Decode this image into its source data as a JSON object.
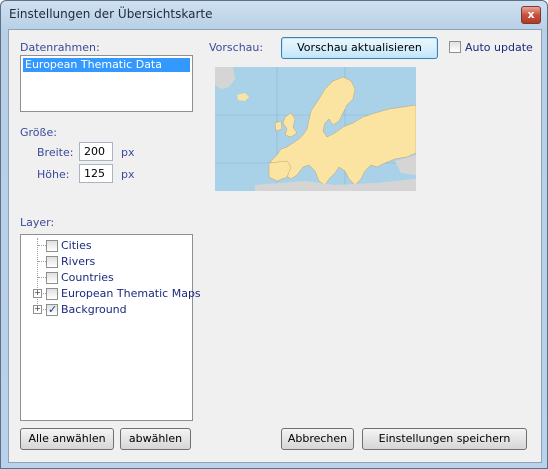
{
  "window": {
    "title": "Einstellungen der Übersichtskarte",
    "close_glyph": "x"
  },
  "datenrahmen": {
    "label": "Datenrahmen:",
    "items": [
      "European Thematic Data"
    ]
  },
  "groesse": {
    "label": "Größe:",
    "breite_label": "Breite:",
    "breite_value": "200",
    "hoehe_label": "Höhe:",
    "hoehe_value": "125",
    "unit": "px"
  },
  "layer": {
    "label": "Layer:",
    "items": [
      {
        "label": "Cities",
        "checked": false,
        "expandable": false
      },
      {
        "label": "Rivers",
        "checked": false,
        "expandable": false
      },
      {
        "label": "Countries",
        "checked": false,
        "expandable": false
      },
      {
        "label": "European Thematic Maps",
        "checked": false,
        "expandable": true
      },
      {
        "label": "Background",
        "checked": true,
        "expandable": true
      }
    ]
  },
  "vorschau": {
    "label": "Vorschau:",
    "refresh_button": "Vorschau aktualisieren",
    "auto_update_label": "Auto update",
    "auto_update_checked": false
  },
  "buttons": {
    "select_all": "Alle anwählen",
    "deselect": "abwählen",
    "cancel": "Abbrechen",
    "save": "Einstellungen speichern"
  },
  "colors": {
    "water": "#a9d2e8",
    "land": "#fbe4a2",
    "other_land": "#d5d5d5",
    "selection": "#3399ff"
  }
}
